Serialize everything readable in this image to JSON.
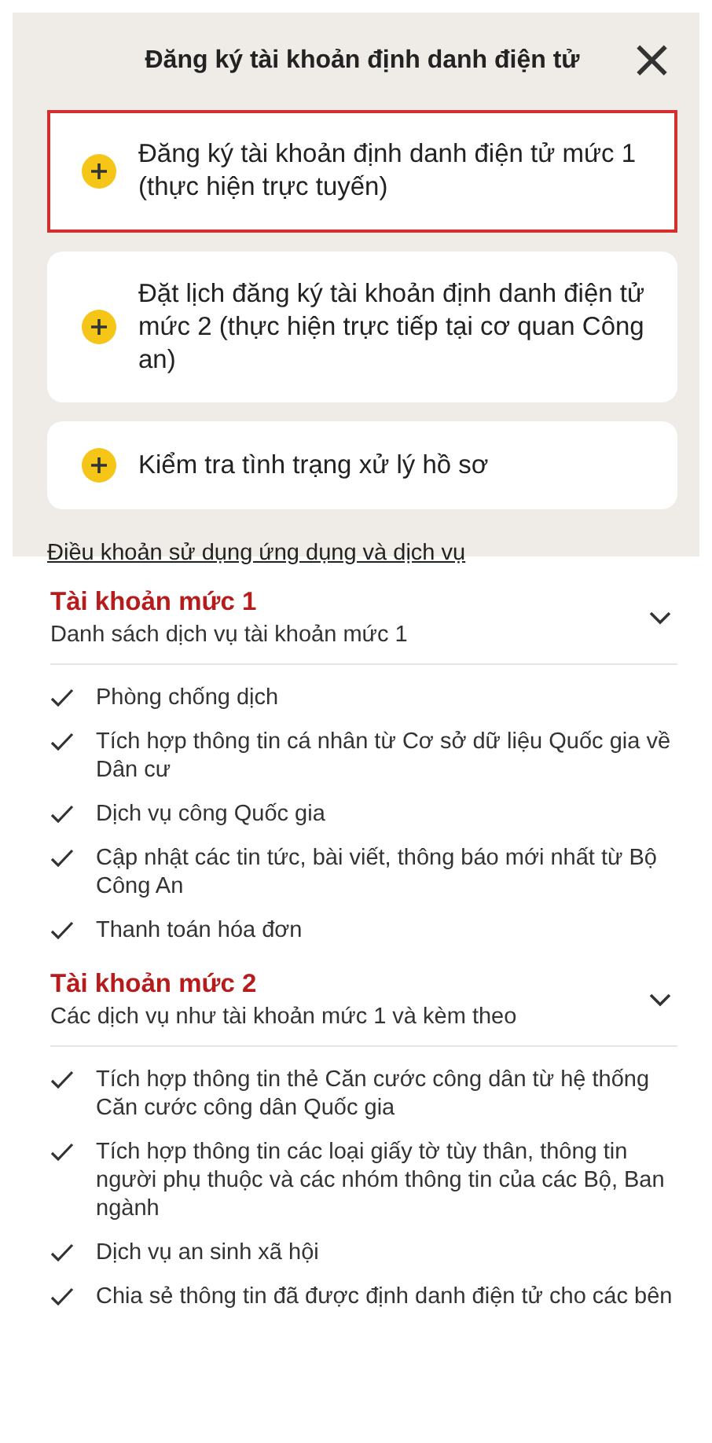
{
  "dialog": {
    "title": "Đăng ký tài khoản định danh điện tử",
    "close": "×"
  },
  "options": [
    {
      "label": "Đăng ký tài khoản định danh điện tử mức 1 (thực hiện trực tuyến)",
      "highlighted": true
    },
    {
      "label": "Đặt lịch đăng ký tài khoản định danh điện tử mức 2 (thực hiện trực tiếp tại cơ quan Công an)",
      "highlighted": false
    },
    {
      "label": "Kiểm tra tình trạng xử lý hồ sơ",
      "highlighted": false
    }
  ],
  "terms_link": "Điều khoản sử dụng ứng dụng và dịch vụ",
  "sections": [
    {
      "title": "Tài khoản mức 1",
      "subtitle": "Danh sách dịch vụ tài khoản mức 1",
      "items": [
        "Phòng chống dịch",
        "Tích hợp thông tin cá nhân từ Cơ sở dữ liệu Quốc gia về Dân cư",
        "Dịch vụ công Quốc gia",
        "Cập nhật các tin tức, bài viết, thông báo mới nhất từ Bộ Công An",
        "Thanh toán hóa đơn"
      ]
    },
    {
      "title": "Tài khoản mức 2",
      "subtitle": "Các dịch vụ như tài khoản mức 1 và kèm theo",
      "items": [
        "Tích hợp thông tin thẻ Căn cước công dân từ hệ thống Căn cước công dân Quốc gia",
        "Tích hợp thông tin các loại giấy tờ tùy thân, thông tin người phụ thuộc và các nhóm thông tin của các Bộ, Ban ngành",
        "Dịch vụ an sinh xã hội",
        "Chia sẻ thông tin đã được định danh điện tử cho các bên"
      ]
    }
  ]
}
